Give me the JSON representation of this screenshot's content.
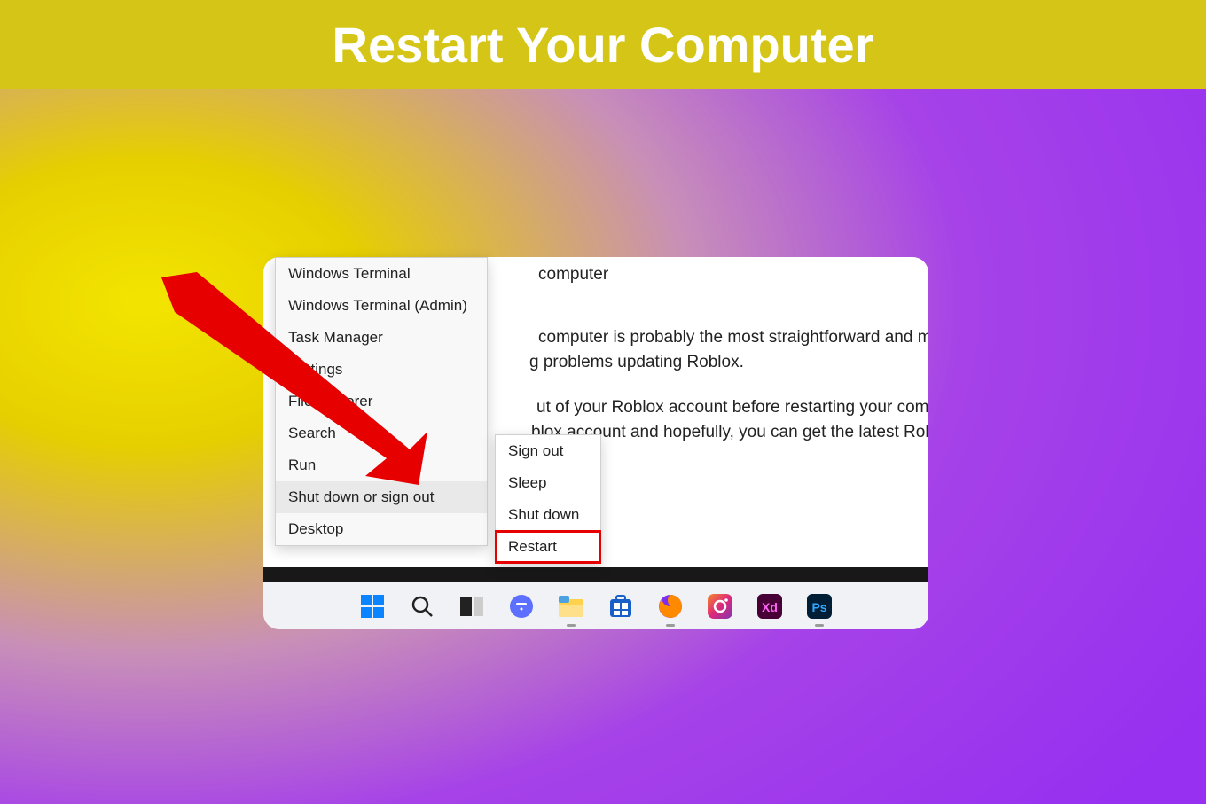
{
  "banner": {
    "title": "Restart Your Computer"
  },
  "doc": {
    "frag1": "computer",
    "frag2": "computer is probably the most straightforward and most comm",
    "frag3": "g problems updating Roblox.",
    "frag4": "ut of your Roblox account before restarting your computer. Onc",
    "frag5": "blox account and hopefully, you can get the latest Roblox versio"
  },
  "context_menu": {
    "items": [
      "Windows Terminal",
      "Windows Terminal (Admin)",
      "Task Manager",
      "Settings",
      "File Explorer",
      "Search",
      "Run",
      "Shut down or sign out",
      "Desktop"
    ],
    "hover_index": 7
  },
  "submenu": {
    "items": [
      "Sign out",
      "Sleep",
      "Shut down",
      "Restart"
    ],
    "highlight_index": 3
  },
  "taskbar": {
    "icons": [
      {
        "name": "start-icon"
      },
      {
        "name": "search-icon"
      },
      {
        "name": "taskview-icon"
      },
      {
        "name": "chat-icon"
      },
      {
        "name": "explorer-icon",
        "pinned": true
      },
      {
        "name": "store-icon"
      },
      {
        "name": "firefox-icon",
        "pinned": true
      },
      {
        "name": "instagram-icon"
      },
      {
        "name": "xd-icon"
      },
      {
        "name": "photoshop-icon",
        "pinned": true
      }
    ]
  },
  "colors": {
    "highlight_red": "#e60000",
    "banner_bg": "#d5c516"
  }
}
